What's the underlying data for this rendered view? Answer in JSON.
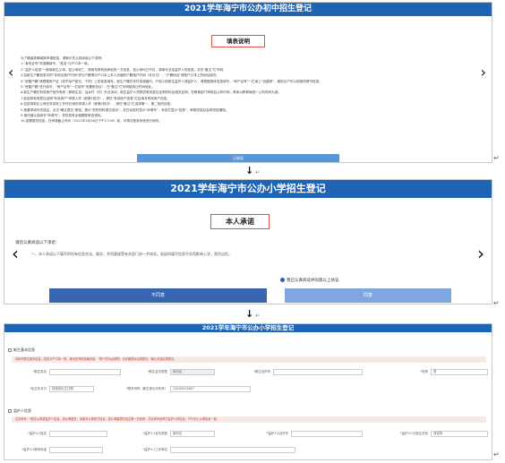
{
  "panel1": {
    "title": "2021学年海宁市公办初中招生登记",
    "fill_title": "填表说明",
    "nav_left": "‹",
    "nav_right": "›",
    "instructions": [
      "为了确保准确填报申请信息，请家长先认真阅读以下说明：",
      "1.\"身份证号\"须准确填写，\"姓名\"与户口本一致。",
      "2.\"监护人信息\"一般填新生父母，如父母双亡，请填写具有抚养权的一方信息，如父母均已不在，请填写法定监护人的信息，并在\"备注\"栏写明。",
      "3.如新生户籍信息中的\"本地址落户时间\"须与户籍簿中户口本上本人页面的户籍落户时间（年月日），\"户籍地址\"请按户口本上的地址填写。",
      "4.\"房屋户籍\"请根据房产证（或不动产登记，下同）上的信息填写。新生户籍在本村选调面内，产权人即新生监护人或监护人，请根据具体信息填写。\"房产证号\"一栏填上\"自建房\"，被拆迁户可以填报申请书信息。",
      "5.\"房屋户籍\"进行填写，\"房产证号\"一栏填写\"安置房协议\"，在\"备注\"栏写明被拆迁时间地址。",
      "6.新生户籍在有效房产权所有房（即新生住）及乡村（村）外出流动，新生监护人须提供有效居住证明材料及相关证明，在教育部门审核后公布时间，具体以教育局统一公布时间为准。",
      "7.如选择有效居住证明\"有效房产\"申请入学（即第1批次），请在\"有效房产信息\"栏目填写有效房产信息。",
      "8.如选择新生父母任务或有工作所在地的申请入学（即第2批次），请在\"备注\"栏选择第一、第二批的信息。",
      "9.按要求填写完成后，点击\"确认提交\"按钮，提示\"您的材料提交成功\"，并在动态时显示\"申请号\"，状态栏显示\"招表\"，审核完成后会有短信通知。",
      "9.请仔细认真填写\"申请书\"，学校将有全程跟踪审查资料。",
      "10.如需更改信息，在申请截止时间（2021年5月18日下午17:00）前，可再次登录系统进行修改。"
    ],
    "known_button": "已阅读"
  },
  "panel2": {
    "title": "2021学年海宁市公办小学招生登记",
    "promise_title": "本人承诺",
    "read_carefully": "请您认真阅读以下承诺：",
    "promise_text": "一、本人承诺以下填写的所有信息合法、真实，并同意接受有关部门进一步核实。若因所填写信息不实而影响入学，责任自负。",
    "nav_left": "‹",
    "nav_right": "›",
    "agree_label": "我已认真阅读并同意以上协议",
    "disagree_button": "不同意",
    "agree_button": "同意"
  },
  "panel3": {
    "title": "2021学年海宁市公办小学招生登记",
    "section1": "新生基本信息",
    "section1_note": "请填写新生基本信息，姓名与户口本一致，身份证号码准确无误，“带*”的为必填项，请仔细核对后再提交，确认无误后再提交。",
    "fields1": [
      {
        "label": "*新生姓名",
        "value": ""
      },
      {
        "label": "*新生证件类型",
        "value": "身份证"
      },
      {
        "label": "*新生证件号",
        "value": ""
      },
      {
        "label": "*性别",
        "value": "男"
      },
      {
        "label": "*出生年月日",
        "value": "请选择出生日期"
      },
      {
        "label": "*联系号码（新生家长手机号）",
        "value": "13456423687"
      }
    ],
    "section2": "监护人信息",
    "section2_note": "注意填写：*新生父母或监护人信息。如父母健在，请填写父母双方信息；如父母离异的请注明一方抚养，并请填写抚养方监护人的信息；户口本上父母信息一致。",
    "fields2": [
      {
        "label": "*监护人1姓名",
        "value": ""
      },
      {
        "label": "*监护人1证件类型",
        "value": "身份证"
      },
      {
        "label": "*监护人1证件号",
        "value": ""
      },
      {
        "label": "*监护人1与新生关系",
        "value": "请选择"
      },
      {
        "label": "*监护人1联系电话",
        "value": ""
      },
      {
        "label": "*监护人1工作单位",
        "value": ""
      }
    ]
  },
  "between1": {
    "arrow": "↓",
    "mark": "↵"
  },
  "between2": {
    "arrow": "↓",
    "mark": "↵"
  },
  "return_mark": "↵"
}
